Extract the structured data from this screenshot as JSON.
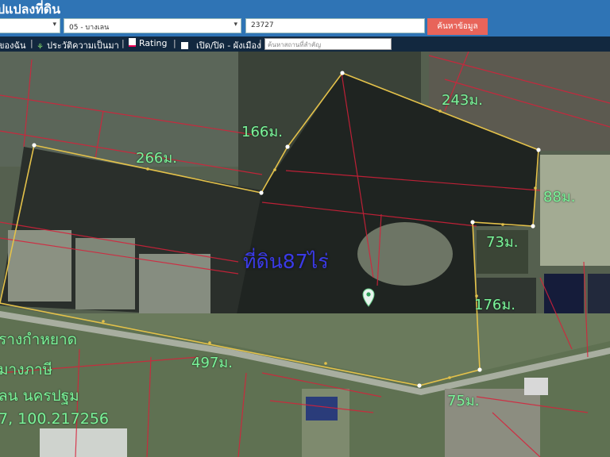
{
  "header": {
    "title": "ปแปลงที่ดิน",
    "district_select": "05 - บางเลน",
    "parcel_input": "23727",
    "search_label": "ค้นหาข้อมูล"
  },
  "toolbar": {
    "item_1": "ของฉัน",
    "item_2": "ประวัติความเป็นมา",
    "item_3": "Rating",
    "item_4": "เปิด/ปิด - ผังเมือง",
    "place_placeholder": "ค้นหาสถานที่สำคัญ"
  },
  "map": {
    "area_label": "ที่ดิน87ไร่",
    "labels": {
      "l243": "243ม.",
      "l166": "166ม.",
      "l266": "266ม.",
      "l88": "88ม.",
      "l73": "73ม.",
      "l176": "176ม.",
      "l497": "497ม.",
      "l75": "75ม."
    },
    "info": {
      "line1": "รางกำหยาด",
      "line2": "มางภาษี",
      "line3": "ลน นครปฐม",
      "line4": "7, 100.217256"
    },
    "colors": {
      "boundary": "#e3c14a",
      "parcel_lines": "#d8203a",
      "labels": "#7cf39a",
      "area_label": "#3a3ae6"
    },
    "marker_icon": "location-pin-icon"
  }
}
